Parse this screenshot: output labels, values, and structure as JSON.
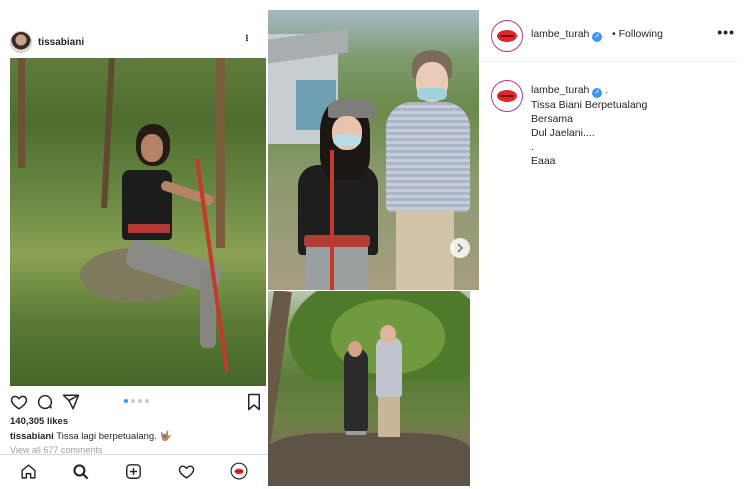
{
  "left_post": {
    "username": "tissabiani",
    "more_label": "...",
    "likes": "140,305 likes",
    "caption_user": "tissabiani",
    "caption_text": "Tissa lagi berpetualang. 🤟🏽",
    "view_all_comments": "View all 677 comments"
  },
  "right_post": {
    "username": "lambe_turah",
    "follow_sep": "•",
    "follow_status": "Following",
    "more_label": "•••",
    "comment_username": "lambe_turah",
    "comment_suffix": ".",
    "comment_lines": [
      "Tissa Biani Berpetualang",
      "Bersama",
      "Dul Jaelani....",
      ".",
      "Eaaa"
    ]
  },
  "icons": {
    "heart": "heart-icon",
    "comment": "comment-icon",
    "share": "share-icon",
    "bookmark": "bookmark-icon",
    "verified": "verified-badge-icon",
    "carousel_next": "chevron-right-icon"
  },
  "colors": {
    "accent_blue": "#3897f0",
    "brand_red": "#e0262b",
    "text": "#262626",
    "muted": "#a0a0a0"
  }
}
